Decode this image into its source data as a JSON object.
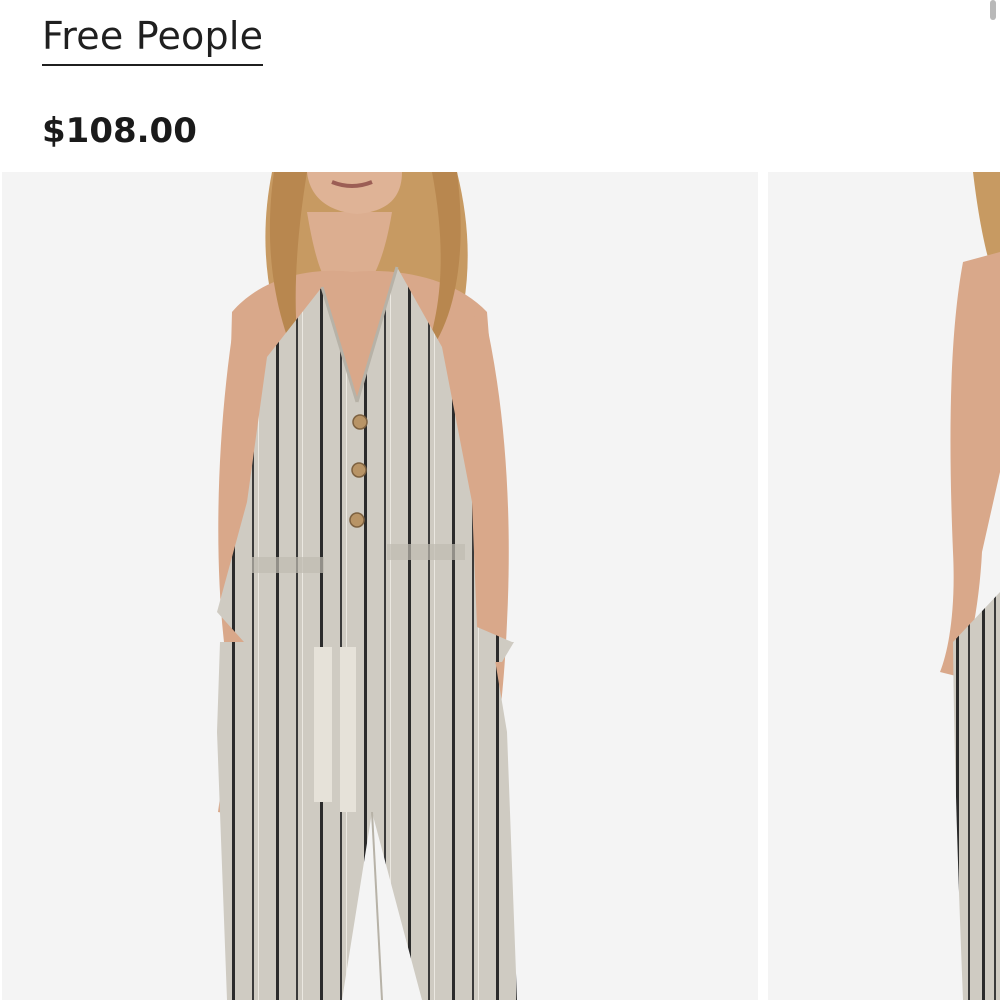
{
  "product": {
    "brand": "Free People",
    "price": "$108.00"
  },
  "gallery": {
    "images": [
      {
        "icon": "product-photo-front"
      },
      {
        "icon": "product-photo-side"
      }
    ]
  },
  "colors": {
    "background": "#ffffff",
    "photo_background": "#f4f4f4",
    "text": "#1a1a1a",
    "fabric": "#cfcbc2",
    "stripe": "#2b2b2b",
    "skin": "#d9a88a",
    "hair": "#c79a62"
  }
}
